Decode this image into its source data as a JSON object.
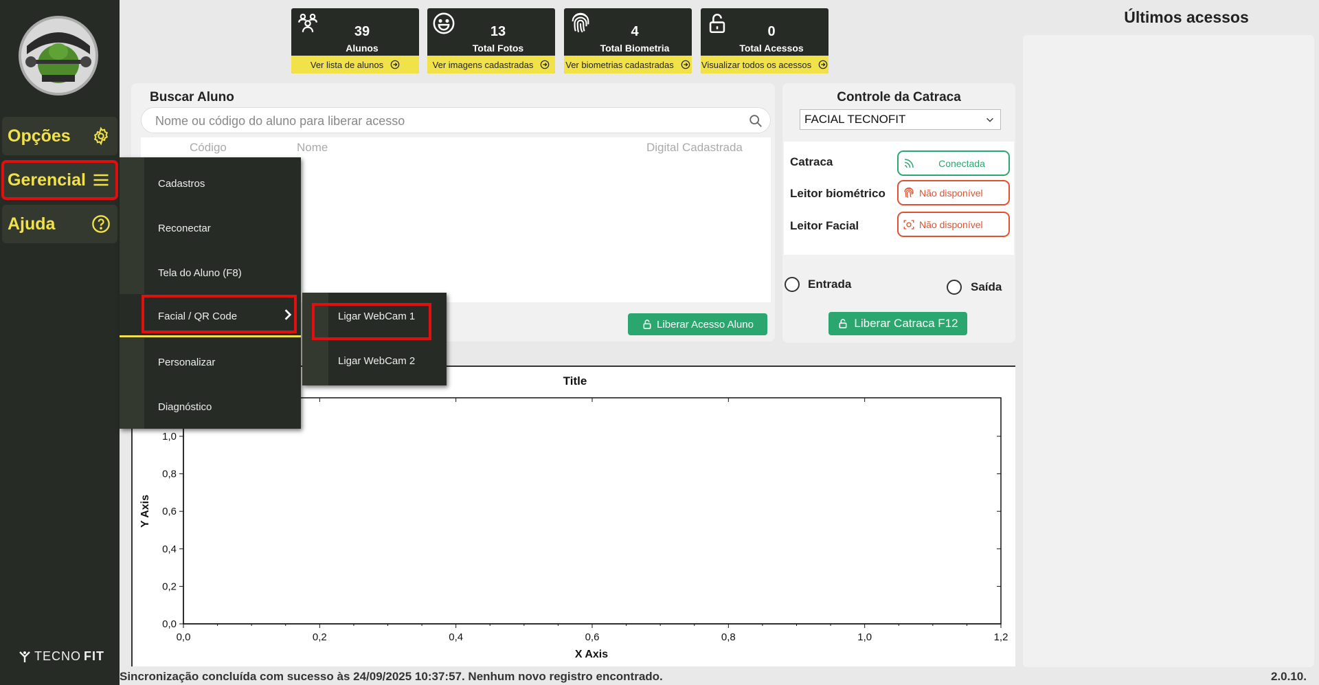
{
  "sidebar": {
    "items": [
      {
        "label": "Opções",
        "icon": "gear-icon"
      },
      {
        "label": "Gerencial",
        "icon": "menu-icon"
      },
      {
        "label": "Ajuda",
        "icon": "help-icon"
      }
    ],
    "brand": {
      "light": "TECNO",
      "bold": "FIT"
    }
  },
  "stats": [
    {
      "value": "39",
      "label": "Alunos",
      "link": "Ver lista de alunos",
      "icon": "users-icon"
    },
    {
      "value": "13",
      "label": "Total Fotos",
      "link": "Ver imagens cadastradas",
      "icon": "smile-icon"
    },
    {
      "value": "4",
      "label": "Total Biometria",
      "link": "Ver biometrias cadastradas",
      "icon": "fingerprint-icon"
    },
    {
      "value": "0",
      "label": "Total Acessos",
      "link": "Visualizar todos os acessos",
      "icon": "unlock-icon"
    }
  ],
  "search": {
    "title": "Buscar Aluno",
    "placeholder": "Nome ou código do aluno para liberar acesso",
    "columns": [
      "Código",
      "Nome",
      "Digital Cadastrada"
    ],
    "action": "Liberar Acesso Aluno"
  },
  "catraca": {
    "title": "Controle da Catraca",
    "selected": "FACIAL TECNOFIT",
    "rows": [
      {
        "label": "Catraca",
        "status": "Conectada",
        "state": "ok"
      },
      {
        "label": "Leitor biométrico",
        "status": "Não disponível",
        "state": "bad"
      },
      {
        "label": "Leitor Facial",
        "status": "Não disponível",
        "state": "bad"
      }
    ],
    "radio_entrada": "Entrada",
    "radio_saida": "Saída",
    "action": "Liberar Catraca F12"
  },
  "ultimos": {
    "title": "Últimos acessos"
  },
  "chart_data": {
    "type": "line",
    "title": "Title",
    "xlabel": "X Axis",
    "ylabel": "Y Axis",
    "xlim": [
      0,
      1.2
    ],
    "ylim": [
      0,
      1.0
    ],
    "xticks": [
      "0,0",
      "0,2",
      "0,4",
      "0,6",
      "0,8",
      "1,0",
      "1,2"
    ],
    "yticks": [
      "0,0",
      "0,2",
      "0,4",
      "0,6",
      "0,8",
      "1,0"
    ],
    "series": []
  },
  "menu": {
    "items": [
      "Cadastros",
      "Reconectar",
      "Tela do Aluno (F8)",
      "Facial / QR Code",
      "Personalizar",
      "Diagnóstico"
    ],
    "submenu": [
      "Ligar WebCam 1",
      "Ligar WebCam 2"
    ]
  },
  "statusbar": {
    "message": "Sincronização concluída com sucesso às 24/09/2025 10:37:57. Nenhum novo registro encontrado.",
    "version": "2.0.10."
  },
  "colors": {
    "accent": "#f2e24a",
    "dark": "#262b26",
    "green": "#2aa66e",
    "red": "#e0502e"
  }
}
